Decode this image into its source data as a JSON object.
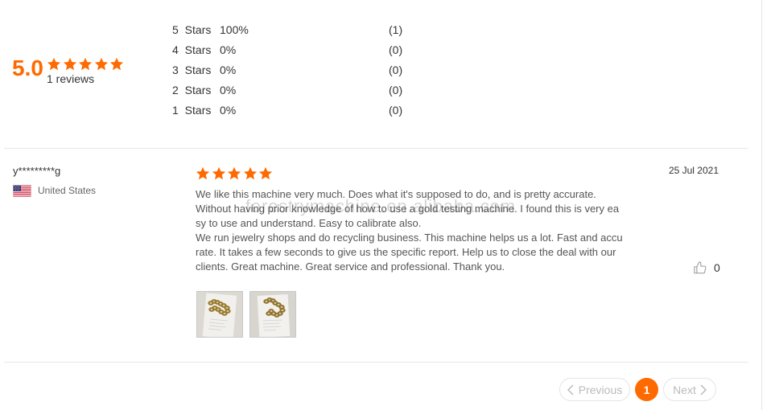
{
  "colors": {
    "accent": "#FF6A00",
    "text": "#333333",
    "body": "#555555",
    "muted": "#666666",
    "disabled": "#BBBBBB"
  },
  "summary": {
    "score": "5.0",
    "stars": 5,
    "star_icon": "star-icon",
    "reviews_label": "1 reviews",
    "breakdown": [
      {
        "label": "5 Stars",
        "percent": "100%",
        "count": "(1)"
      },
      {
        "label": "4 Stars",
        "percent": "0%",
        "count": "(0)"
      },
      {
        "label": "3 Stars",
        "percent": "0%",
        "count": "(0)"
      },
      {
        "label": "2 Stars",
        "percent": "0%",
        "count": "(0)"
      },
      {
        "label": "1 Stars",
        "percent": "0%",
        "count": "(0)"
      }
    ]
  },
  "review": {
    "user": "y*********g",
    "country": "United States",
    "country_flag_icon": "us-flag-icon",
    "stars": 5,
    "date": "25 Jul 2021",
    "text_lines": [
      "We like this machine very much. Does what it's supposed to do, and is pretty accurate.",
      "Without having prior knowledge of how to use a gold testing machine. I found this is very ea",
      "sy to use and understand. Easy to calibrate also.",
      "We run jewelry shops and do recycling business. This machine helps us a lot. Fast and accu",
      "rate. It takes a few seconds to give us the specific report. Help us to close the deal with our",
      "clients. Great machine. Great service and professional. Thank you."
    ],
    "like_icon": "thumbs-up-icon",
    "likes": "0",
    "photos": [
      {
        "icon": "gold-chain-photo"
      },
      {
        "icon": "gold-chain-photo"
      }
    ]
  },
  "watermark": "forestrymachine.en.alibaba.com",
  "pagination": {
    "previous_icon": "chevron-left-icon",
    "previous_label": "Previous",
    "current_page": "1",
    "next_label": "Next",
    "next_icon": "chevron-right-icon"
  }
}
